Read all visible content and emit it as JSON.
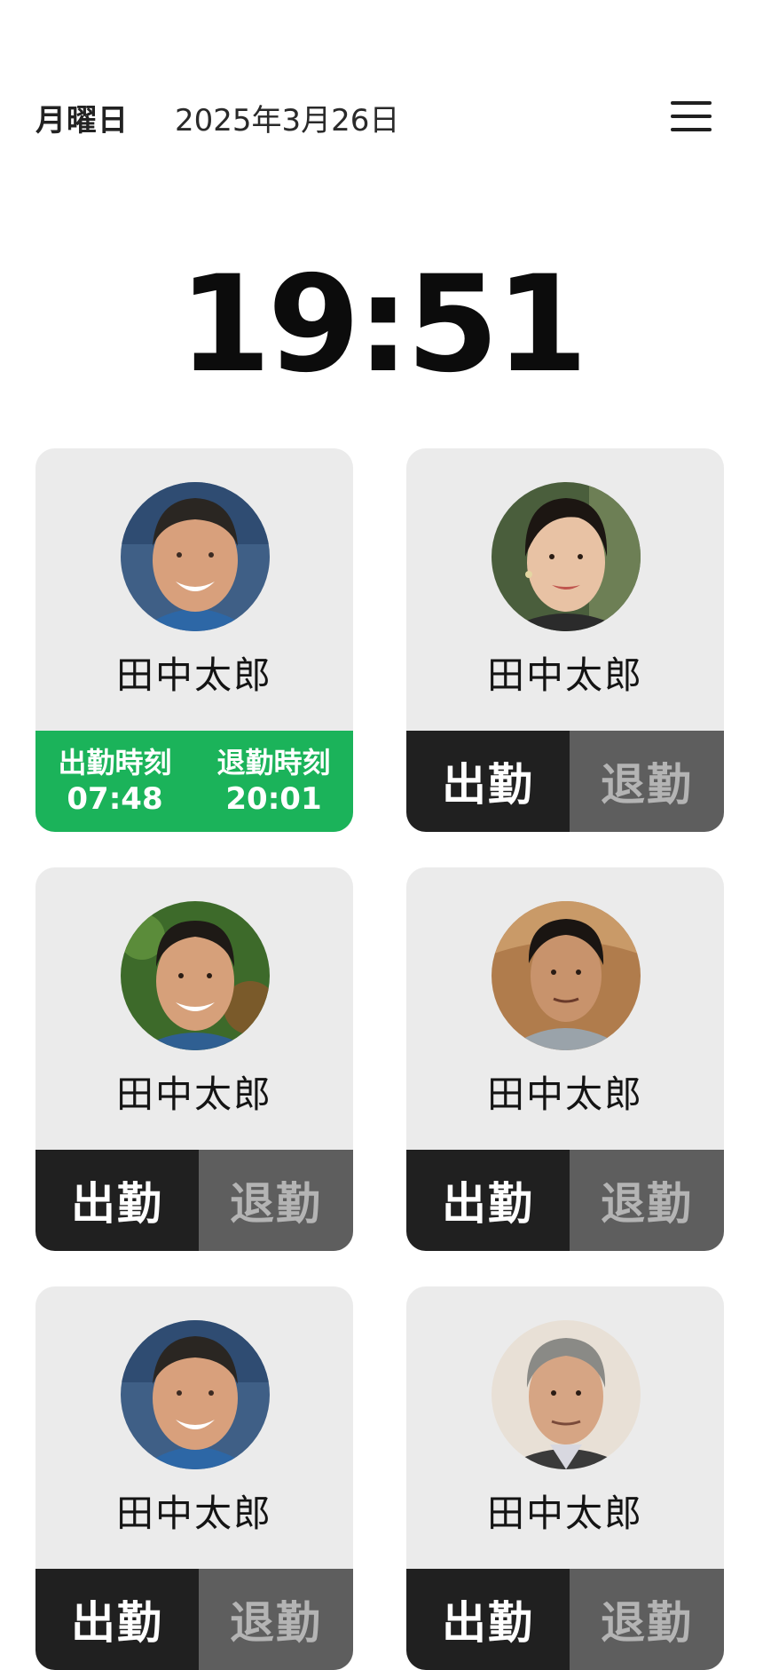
{
  "header": {
    "weekday": "月曜日",
    "date": "2025年3月26日"
  },
  "clock": "19:51",
  "labels": {
    "clock_in": "出勤",
    "clock_out": "退勤",
    "clock_in_time": "出勤時刻",
    "clock_out_time": "退勤時刻"
  },
  "employees": [
    {
      "name": "田中太郎",
      "status": "completed",
      "clock_in_time": "07:48",
      "clock_out_time": "20:01"
    },
    {
      "name": "田中太郎",
      "status": "pending"
    },
    {
      "name": "田中太郎",
      "status": "pending"
    },
    {
      "name": "田中太郎",
      "status": "pending"
    },
    {
      "name": "田中太郎",
      "status": "pending"
    },
    {
      "name": "田中太郎",
      "status": "pending"
    }
  ],
  "colors": {
    "completed": "#1bb35a",
    "clock_in_button": "#202020",
    "clock_out_button": "#5e5e5e",
    "card": "#ebebeb"
  },
  "icons": {
    "menu": "hamburger-menu-icon"
  }
}
